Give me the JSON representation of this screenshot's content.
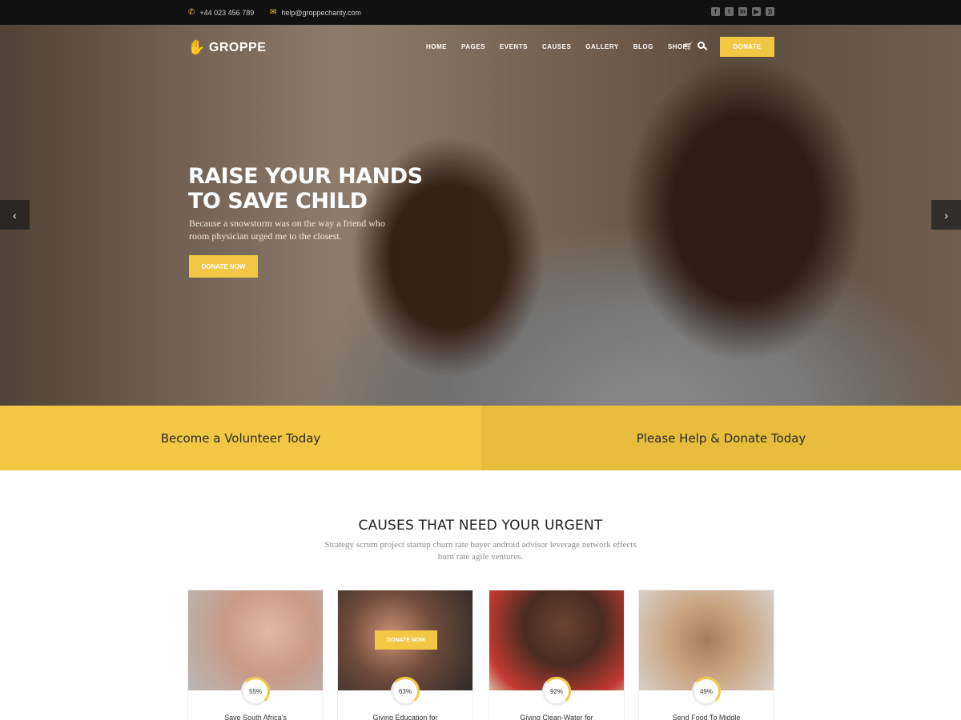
{
  "topbar": {
    "phone": "+44 023 456 789",
    "email": "help@groppecharity.com",
    "social_icons": [
      "facebook-icon",
      "twitter-icon",
      "linkedin-icon",
      "youtube-icon",
      "rss-icon"
    ]
  },
  "brand": {
    "name": "GROPPE",
    "accent_color": "#f2c744"
  },
  "nav": {
    "items": [
      "HOME",
      "PAGES",
      "EVENTS",
      "CAUSES",
      "GALLERY",
      "BLOG",
      "SHOP"
    ],
    "donate_label": "DONATE"
  },
  "hero": {
    "title_line1": "RAISE YOUR HANDS",
    "title_line2": "TO SAVE CHILD",
    "subtitle": "Because a snowstorm was on the way a friend who room physician urged me to the closest.",
    "button_label": "DONATE NOW",
    "prev_arrow": "‹",
    "next_arrow": "›"
  },
  "cta": {
    "volunteer": "Become a Volunteer Today",
    "donate": "Please Help & Donate Today"
  },
  "causes": {
    "title": "CAUSES THAT NEED YOUR URGENT",
    "subtitle": "Strategy scrum project startup churn rate buyer android advisor leverage network effects burn rate agile ventures.",
    "card_button": "DONATE NOW",
    "items": [
      {
        "percent": "55%",
        "title": "Save South Africa's"
      },
      {
        "percent": "63%",
        "title": "Giving Education for"
      },
      {
        "percent": "92%",
        "title": "Giving Clean-Water for"
      },
      {
        "percent": "49%",
        "title": "Send Food To Middle"
      }
    ]
  }
}
